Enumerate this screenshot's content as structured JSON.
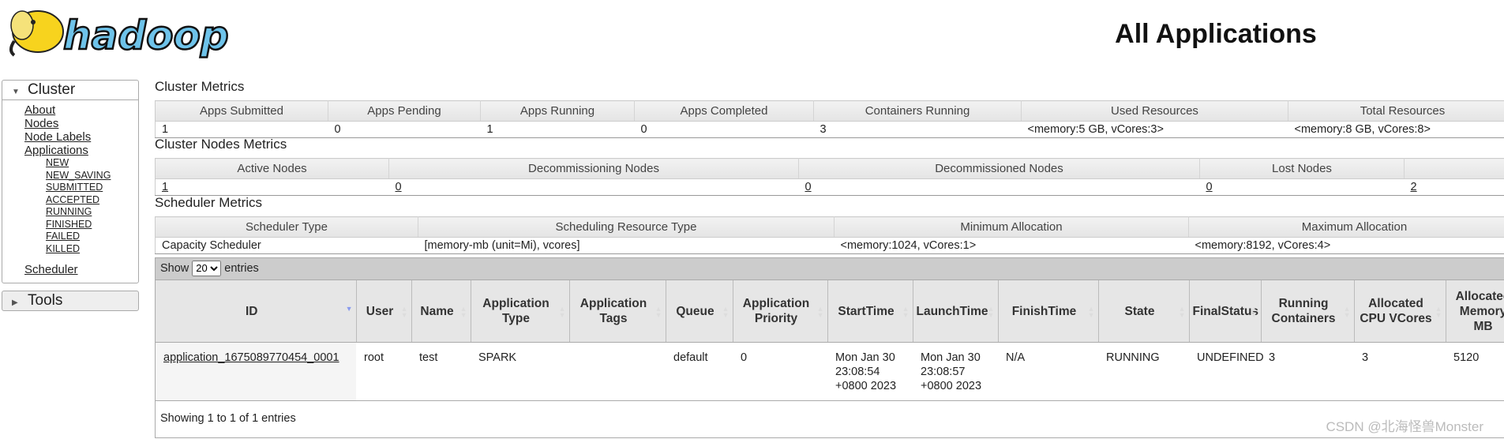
{
  "header": {
    "logo_text": "hadoop",
    "title": "All Applications"
  },
  "sidebar": {
    "cluster": {
      "label": "Cluster",
      "links": [
        "About",
        "Nodes",
        "Node Labels",
        "Applications"
      ],
      "states": [
        "NEW",
        "NEW_SAVING",
        "SUBMITTED",
        "ACCEPTED",
        "RUNNING",
        "FINISHED",
        "FAILED",
        "KILLED"
      ],
      "scheduler": "Scheduler"
    },
    "tools": {
      "label": "Tools"
    }
  },
  "cluster_metrics": {
    "title": "Cluster Metrics",
    "headers": [
      "Apps Submitted",
      "Apps Pending",
      "Apps Running",
      "Apps Completed",
      "Containers Running",
      "Used Resources",
      "Total Resources"
    ],
    "values": [
      "1",
      "0",
      "1",
      "0",
      "3",
      "<memory:5 GB, vCores:3>",
      "<memory:8 GB, vCores:8>"
    ]
  },
  "nodes_metrics": {
    "title": "Cluster Nodes Metrics",
    "headers": [
      "Active Nodes",
      "Decommissioning Nodes",
      "Decommissioned Nodes",
      "Lost Nodes",
      ""
    ],
    "values": [
      "1",
      "0",
      "0",
      "0",
      "2"
    ]
  },
  "scheduler_metrics": {
    "title": "Scheduler Metrics",
    "headers": [
      "Scheduler Type",
      "Scheduling Resource Type",
      "Minimum Allocation",
      "Maximum Allocation"
    ],
    "values": [
      "Capacity Scheduler",
      "[memory-mb (unit=Mi), vcores]",
      "<memory:1024, vCores:1>",
      "<memory:8192, vCores:4>"
    ]
  },
  "apps": {
    "show_label": "Show",
    "page_size": "20",
    "entries_label": "entries",
    "headers": [
      "ID",
      "User",
      "Name",
      "Application Type",
      "Application Tags",
      "Queue",
      "Application Priority",
      "StartTime",
      "LaunchTime",
      "FinishTime",
      "State",
      "FinalStatus",
      "Running Containers",
      "Allocated CPU VCores",
      "Allocated Memory MB"
    ],
    "rows": [
      [
        "application_1675089770454_0001",
        "root",
        "test",
        "SPARK",
        "",
        "default",
        "0",
        "Mon Jan 30 23:08:54 +0800 2023",
        "Mon Jan 30 23:08:57 +0800 2023",
        "N/A",
        "RUNNING",
        "UNDEFINED",
        "3",
        "3",
        "5120"
      ]
    ],
    "footer": "Showing 1 to 1 of 1 entries"
  },
  "watermark": "CSDN @北海怪兽Monster"
}
